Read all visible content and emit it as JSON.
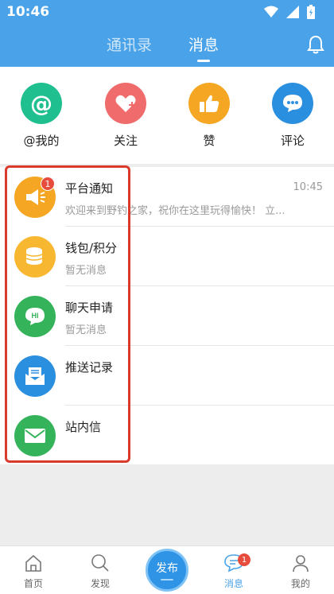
{
  "status_bar": {
    "time": "10:46"
  },
  "header": {
    "tabs": [
      {
        "label": "通讯录",
        "active": false
      },
      {
        "label": "消息",
        "active": true
      }
    ],
    "bell_icon": "bell-icon"
  },
  "quick_actions": [
    {
      "label": "@我的",
      "icon": "at-icon",
      "color": "#1fbf8f"
    },
    {
      "label": "关注",
      "icon": "heart-plus-icon",
      "color": "#f06b6b"
    },
    {
      "label": "赞",
      "icon": "thumbs-up-icon",
      "color": "#f5a623"
    },
    {
      "label": "评论",
      "icon": "comment-icon",
      "color": "#2b8fe0"
    }
  ],
  "messages": [
    {
      "title": "平台通知",
      "subtitle": "欢迎来到野钓之家，祝你在这里玩得愉快！ 立...",
      "time": "10:45",
      "badge": "1",
      "icon": "megaphone-icon",
      "color": "#f5a623"
    },
    {
      "title": "钱包/积分",
      "subtitle": "暂无消息",
      "time": "",
      "badge": "",
      "icon": "coins-icon",
      "color": "#f7b731"
    },
    {
      "title": "聊天申请",
      "subtitle": "暂无消息",
      "time": "",
      "badge": "",
      "icon": "chat-hi-icon",
      "color": "#34b35a"
    },
    {
      "title": "推送记录",
      "subtitle": "",
      "time": "",
      "badge": "",
      "icon": "mail-tray-icon",
      "color": "#2b8fe0"
    },
    {
      "title": "站内信",
      "subtitle": "",
      "time": "",
      "badge": "",
      "icon": "envelope-icon",
      "color": "#34b35a"
    }
  ],
  "bottom_nav": {
    "items": [
      {
        "label": "首页",
        "icon": "home-icon"
      },
      {
        "label": "发现",
        "icon": "search-icon"
      },
      {
        "label": "消息",
        "icon": "message-icon",
        "active": true,
        "badge": "1"
      },
      {
        "label": "我的",
        "icon": "user-icon"
      }
    ],
    "publish_label": "发布"
  },
  "colors": {
    "accent": "#4aa3e9",
    "highlight_border": "#d93a2b",
    "badge": "#e74c3c"
  }
}
